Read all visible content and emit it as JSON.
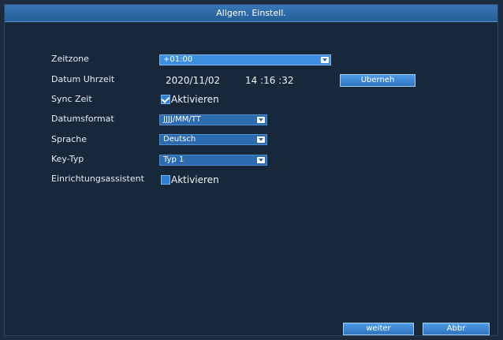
{
  "window": {
    "title": "Allgem. Einstell."
  },
  "fields": {
    "timezone": {
      "label": "Zeitzone",
      "value": "+01:00"
    },
    "datetime": {
      "label": "Datum Uhrzeit",
      "date": "2020/11/02",
      "time": "14 :16 :32",
      "apply_button": "Uberneh"
    },
    "sync_time": {
      "label": "Sync Zeit",
      "checkbox_label": "Aktivieren",
      "checked": true
    },
    "date_format": {
      "label": "Datumsformat",
      "value": "JJJJ/MM/TT"
    },
    "language": {
      "label": "Sprache",
      "value": "Deutsch"
    },
    "key_type": {
      "label": "Key-Typ",
      "value": "Typ 1"
    },
    "setup_wizard": {
      "label": "Einrichtungsassistent",
      "checkbox_label": "Aktivieren",
      "checked": true
    }
  },
  "footer": {
    "next_button": "weiter",
    "cancel_button": "Abbr"
  },
  "colors": {
    "background": "#17283b",
    "titlebar": "#2f6aa8",
    "accent": "#2c7fd3"
  },
  "icons": {
    "dropdown_arrow": "chevron-down-icon",
    "checkmark": "checkmark-icon"
  }
}
